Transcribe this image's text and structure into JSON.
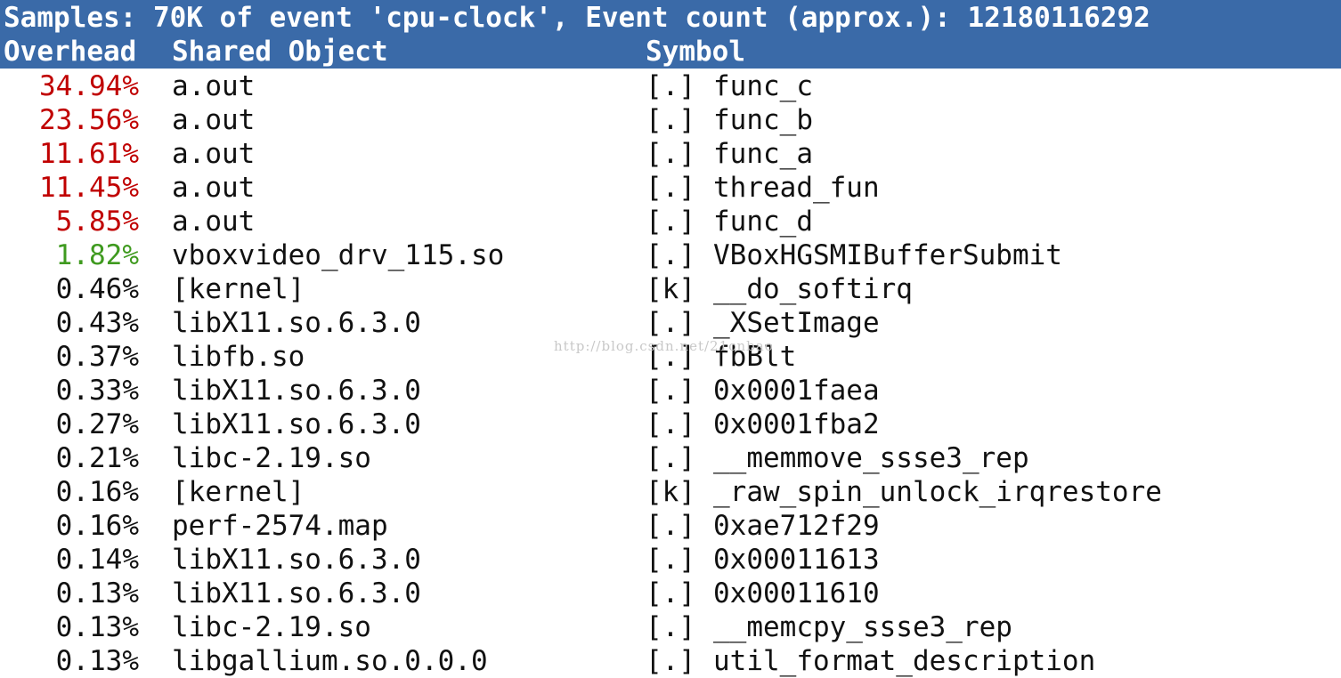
{
  "header": {
    "title": "Samples: 70K of event 'cpu-clock', Event count (approx.): 12180116292",
    "col_overhead": "Overhead",
    "col_object": "Shared Object",
    "col_symbol": "Symbol"
  },
  "colors": {
    "header_bg": "#3a6aa8",
    "header_fg": "#ffffff",
    "high": "#c00000",
    "medium": "#3f9a1f",
    "normal": "#111111"
  },
  "rows": [
    {
      "overhead": "34.94%",
      "object": "a.out",
      "level": "[.]",
      "symbol": "func_c",
      "heat": "high"
    },
    {
      "overhead": "23.56%",
      "object": "a.out",
      "level": "[.]",
      "symbol": "func_b",
      "heat": "high"
    },
    {
      "overhead": "11.61%",
      "object": "a.out",
      "level": "[.]",
      "symbol": "func_a",
      "heat": "high"
    },
    {
      "overhead": "11.45%",
      "object": "a.out",
      "level": "[.]",
      "symbol": "thread_fun",
      "heat": "high"
    },
    {
      "overhead": "5.85%",
      "object": "a.out",
      "level": "[.]",
      "symbol": "func_d",
      "heat": "high"
    },
    {
      "overhead": "1.82%",
      "object": "vboxvideo_drv_115.so",
      "level": "[.]",
      "symbol": "VBoxHGSMIBufferSubmit",
      "heat": "medium"
    },
    {
      "overhead": "0.46%",
      "object": "[kernel]",
      "level": "[k]",
      "symbol": "__do_softirq",
      "heat": "normal"
    },
    {
      "overhead": "0.43%",
      "object": "libX11.so.6.3.0",
      "level": "[.]",
      "symbol": "_XSetImage",
      "heat": "normal"
    },
    {
      "overhead": "0.37%",
      "object": "libfb.so",
      "level": "[.]",
      "symbol": "fbBlt",
      "heat": "normal"
    },
    {
      "overhead": "0.33%",
      "object": "libX11.so.6.3.0",
      "level": "[.]",
      "symbol": "0x0001faea",
      "heat": "normal"
    },
    {
      "overhead": "0.27%",
      "object": "libX11.so.6.3.0",
      "level": "[.]",
      "symbol": "0x0001fba2",
      "heat": "normal"
    },
    {
      "overhead": "0.21%",
      "object": "libc-2.19.so",
      "level": "[.]",
      "symbol": "__memmove_ssse3_rep",
      "heat": "normal"
    },
    {
      "overhead": "0.16%",
      "object": "[kernel]",
      "level": "[k]",
      "symbol": "_raw_spin_unlock_irqrestore",
      "heat": "normal"
    },
    {
      "overhead": "0.16%",
      "object": "perf-2574.map",
      "level": "[.]",
      "symbol": "0xae712f29",
      "heat": "normal"
    },
    {
      "overhead": "0.14%",
      "object": "libX11.so.6.3.0",
      "level": "[.]",
      "symbol": "0x00011613",
      "heat": "normal"
    },
    {
      "overhead": "0.13%",
      "object": "libX11.so.6.3.0",
      "level": "[.]",
      "symbol": "0x00011610",
      "heat": "normal"
    },
    {
      "overhead": "0.13%",
      "object": "libc-2.19.so",
      "level": "[.]",
      "symbol": "__memcpy_ssse3_rep",
      "heat": "normal"
    },
    {
      "overhead": "0.13%",
      "object": "libgallium.so.0.0.0",
      "level": "[.]",
      "symbol": "util_format_description",
      "heat": "normal"
    }
  ],
  "watermark": "http://blog.csdn.net/21cnbao"
}
